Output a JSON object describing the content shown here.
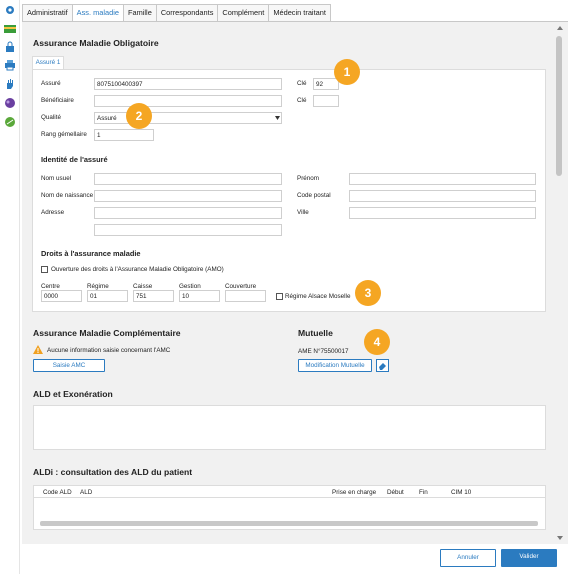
{
  "tabs": [
    "Administratif",
    "Ass. maladie",
    "Famille",
    "Correspondants",
    "Complément",
    "Médecin traitant"
  ],
  "amo": {
    "title": "Assurance Maladie Obligatoire",
    "subtab": "Assuré 1",
    "assure_label": "Assuré",
    "assure_value": "8075100400397",
    "cle_label": "Clé",
    "cle_value": "92",
    "beneficiaire_label": "Bénéficiaire",
    "cle2_label": "Clé",
    "qualite_label": "Qualité",
    "qualite_value": "Assuré",
    "rang_label": "Rang gémellaire",
    "rang_value": "1",
    "identite_title": "Identité de l'assuré",
    "nom_usuel": "Nom usuel",
    "prenom": "Prénom",
    "nom_naissance": "Nom de naissance",
    "code_postal": "Code postal",
    "adresse": "Adresse",
    "ville": "Ville",
    "droits_title": "Droits à l'assurance maladie",
    "ouverture": "Ouverture des droits à l'Assurance Maladie Obligatoire (AMO)",
    "centre_label": "Centre",
    "centre_value": "0000",
    "regime_label": "Régime",
    "regime_value": "01",
    "caisse_label": "Caisse",
    "caisse_value": "751",
    "gestion_label": "Gestion",
    "gestion_value": "10",
    "couverture_label": "Couverture",
    "alsace": "Régime Alsace Moselle"
  },
  "amc": {
    "title": "Assurance Maladie Complémentaire",
    "warning": "Aucune information saisie concernant l'AMC",
    "saisie_btn": "Saisie AMC"
  },
  "mutuelle": {
    "title": "Mutuelle",
    "ame": "AME N°75500017",
    "modif_btn": "Modification Mutuelle"
  },
  "ald": {
    "title": "ALD et Exonération"
  },
  "aldi": {
    "title": "ALDi : consultation des ALD du patient",
    "columns": [
      "Code ALD",
      "ALD",
      "Prise en charge",
      "Début",
      "Fin",
      "CIM 10"
    ]
  },
  "footer": {
    "cancel": "Annuler",
    "validate": "Valider"
  },
  "badges": [
    "1",
    "2",
    "3",
    "4"
  ],
  "colors": {
    "accent": "#2b7bc0",
    "badge": "#f5a623"
  }
}
